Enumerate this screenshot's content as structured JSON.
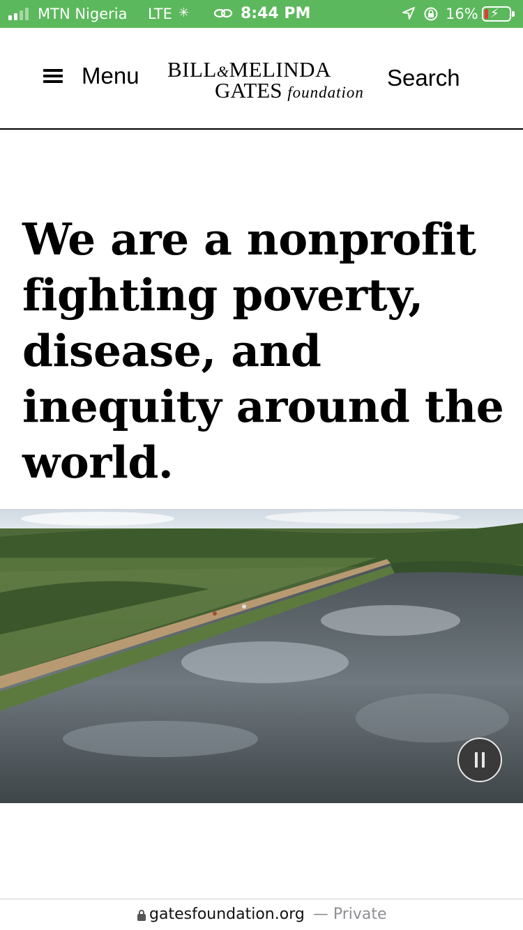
{
  "status_bar": {
    "carrier": "MTN Nigeria",
    "network": "LTE",
    "time": "8:44 PM",
    "battery_percent": "16%",
    "battery_level": 0.16,
    "signal_bars": 2,
    "icons": [
      "signal-icon",
      "loading-spinner-icon",
      "link-icon",
      "location-arrow-icon",
      "rotation-lock-icon",
      "battery-charging-icon"
    ],
    "colors": {
      "background": "#5cb85c",
      "battery_low": "#e53935"
    }
  },
  "header": {
    "menu_label": "Menu",
    "search_label": "Search",
    "logo": {
      "line1_a": "BILL",
      "ampersand": "&",
      "line1_b": "MELINDA",
      "line2_a": "GATES",
      "line2_b": "foundation"
    }
  },
  "headline": "We are a nonprofit fighting poverty, disease, and inequity around the world.",
  "hero": {
    "media": "aerial landscape video with river",
    "pause_icon": "pause-icon"
  },
  "url_bar": {
    "domain": "gatesfoundation.org",
    "mode": "— Private"
  }
}
